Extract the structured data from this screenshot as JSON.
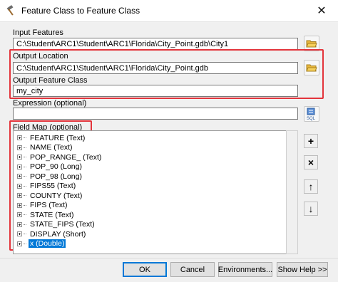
{
  "window": {
    "title": "Feature Class to Feature Class",
    "close_glyph": "✕"
  },
  "input_features": {
    "label": "Input Features",
    "value": "C:\\Student\\ARC1\\Student\\ARC1\\Florida\\City_Point.gdb\\City1"
  },
  "output_location": {
    "label": "Output Location",
    "value": "C:\\Student\\ARC1\\Student\\ARC1\\Florida\\City_Point.gdb"
  },
  "output_feature_class": {
    "label": "Output Feature Class",
    "value": "my_city"
  },
  "expression": {
    "label": "Expression (optional)",
    "value": "",
    "sql_icon_text": "SQL"
  },
  "field_map": {
    "label": "Field Map (optional)",
    "fields": [
      "FEATURE (Text)",
      "NAME (Text)",
      "POP_RANGE_ (Text)",
      "POP_90 (Long)",
      "POP_98 (Long)",
      "FIPS55 (Text)",
      "COUNTY (Text)",
      "FIPS (Text)",
      "STATE (Text)",
      "STATE_FIPS (Text)",
      "DISPLAY (Short)",
      "x (Double)"
    ],
    "selected_index": 11
  },
  "side_buttons": {
    "add": "+",
    "delete": "×",
    "up": "↑",
    "down": "↓"
  },
  "footer": {
    "ok": "OK",
    "cancel": "Cancel",
    "environments": "Environments...",
    "show_help": "Show Help >>"
  },
  "colors": {
    "highlight": "#e3343b",
    "selection": "#0078d7"
  },
  "icons": [
    "hammer-icon",
    "close-icon",
    "folder-icon",
    "sql-icon",
    "plus-icon",
    "delete-icon",
    "arrow-up-icon",
    "arrow-down-icon",
    "expander-icon"
  ]
}
